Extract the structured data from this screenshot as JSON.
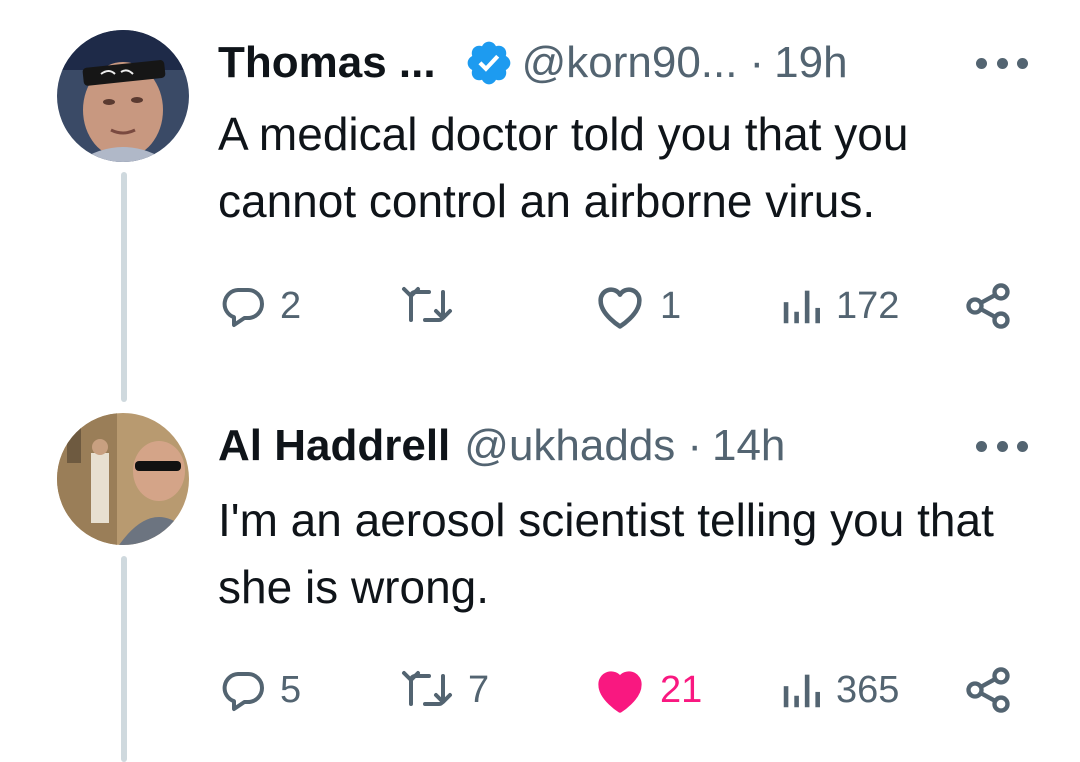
{
  "tweets": [
    {
      "name": "Thomas ...",
      "verified": true,
      "handle": "@korn90...",
      "separator": "·",
      "time": "19h",
      "text": "A medical doctor told you that you cannot control an airborne virus.",
      "replies": "2",
      "retweets": "",
      "likes": "1",
      "liked": false,
      "views": "172"
    },
    {
      "name": "Al Haddrell",
      "verified": false,
      "handle": "@ukhadds",
      "separator": "·",
      "time": "14h",
      "text": "I'm an aerosol scientist telling you that she is wrong.",
      "replies": "5",
      "retweets": "7",
      "likes": "21",
      "liked": true,
      "views": "365"
    }
  ],
  "colors": {
    "text": "#0f1419",
    "secondary": "#536471",
    "verified": "#1d9bf0",
    "like": "#f91880",
    "thread_line": "#cfd9de"
  },
  "icons": [
    "verified-badge-icon",
    "more-icon",
    "reply-icon",
    "retweet-icon",
    "like-icon",
    "views-icon",
    "share-icon"
  ]
}
